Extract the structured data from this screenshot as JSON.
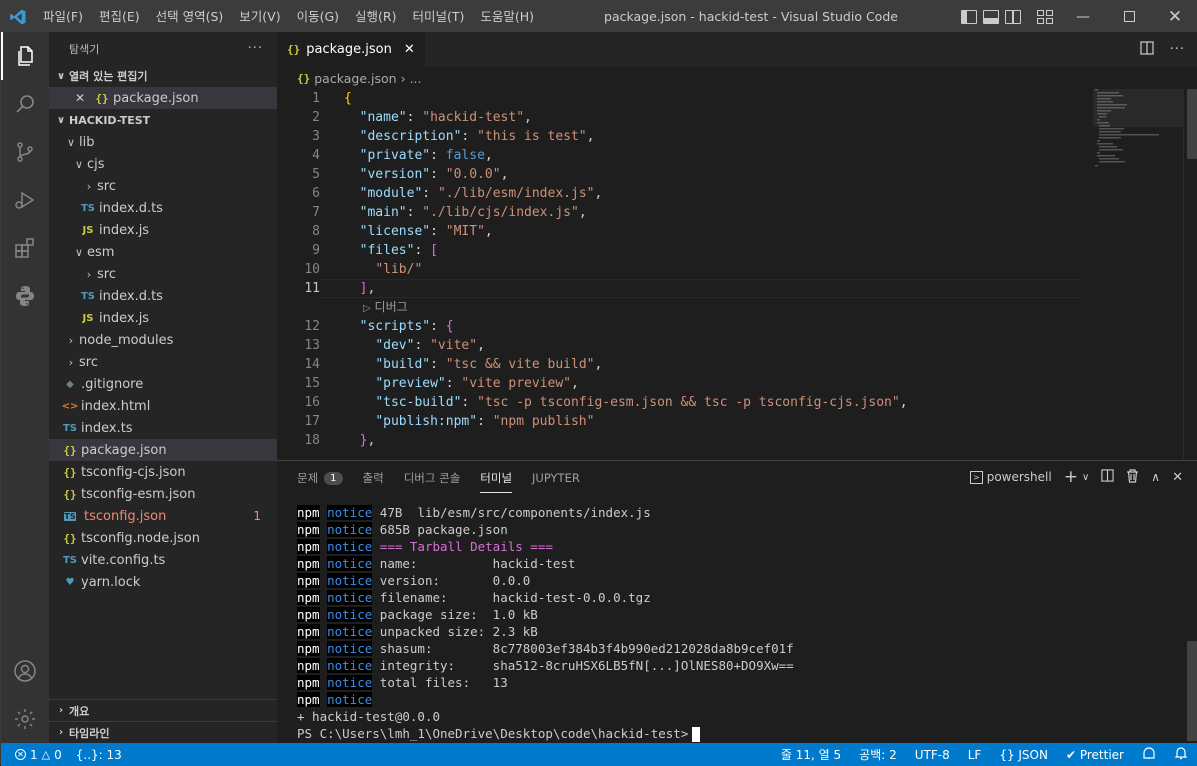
{
  "titlebar": {
    "menu": [
      "파일(F)",
      "편집(E)",
      "선택 영역(S)",
      "보기(V)",
      "이동(G)",
      "실행(R)",
      "터미널(T)",
      "도움말(H)"
    ],
    "title": "package.json - hackid-test - Visual Studio Code"
  },
  "sidebar": {
    "title": "탐색기",
    "more": "···",
    "open_editors_label": "열려 있는 편집기",
    "open_editor_file": "package.json",
    "project_label": "HACKID-TEST",
    "tree": [
      {
        "label": "lib",
        "type": "folder-open"
      },
      {
        "label": "cjs",
        "type": "folder-open"
      },
      {
        "label": "src",
        "type": "folder"
      },
      {
        "label": "index.d.ts",
        "icon": "TS"
      },
      {
        "label": "index.js",
        "icon": "JS"
      },
      {
        "label": "esm",
        "type": "folder-open"
      },
      {
        "label": "src",
        "type": "folder"
      },
      {
        "label": "index.d.ts",
        "icon": "TS"
      },
      {
        "label": "index.js",
        "icon": "JS"
      },
      {
        "label": "node_modules",
        "type": "folder"
      },
      {
        "label": "src",
        "type": "folder"
      },
      {
        "label": ".gitignore",
        "icon": "git"
      },
      {
        "label": "index.html",
        "icon": "<>"
      },
      {
        "label": "index.ts",
        "icon": "TS"
      },
      {
        "label": "package.json",
        "icon": "{}"
      },
      {
        "label": "tsconfig-cjs.json",
        "icon": "{}"
      },
      {
        "label": "tsconfig-esm.json",
        "icon": "{}"
      },
      {
        "label": "tsconfig.json",
        "icon": "TS",
        "badge": "1"
      },
      {
        "label": "tsconfig.node.json",
        "icon": "{}"
      },
      {
        "label": "vite.config.ts",
        "icon": "TS"
      },
      {
        "label": "yarn.lock",
        "icon": "yarn"
      }
    ],
    "outline_label": "개요",
    "timeline_label": "타임라인"
  },
  "editor": {
    "tab_label": "package.json",
    "breadcrumb_file": "package.json",
    "breadcrumb_more": "...",
    "codelens": "디버그",
    "line_numbers": [
      "1",
      "2",
      "3",
      "4",
      "5",
      "6",
      "7",
      "8",
      "9",
      "10",
      "11",
      "12",
      "13",
      "14",
      "15",
      "16",
      "17",
      "18"
    ],
    "current_line": "11"
  },
  "panel": {
    "tabs": [
      "문제",
      "출력",
      "디버그 콘솔",
      "터미널",
      "JUPYTER"
    ],
    "problems_count": "1",
    "active_tab": "터미널",
    "shell": "powershell",
    "terminal_lines": [
      {
        "text": " 47B  lib/esm/src/components/index.js"
      },
      {
        "text": " 685B package.json"
      },
      {
        "text": " === Tarball Details ===",
        "magenta": true
      },
      {
        "text": " name:          hackid-test"
      },
      {
        "text": " version:       0.0.0"
      },
      {
        "text": " filename:      hackid-test-0.0.0.tgz"
      },
      {
        "text": " package size:  1.0 kB"
      },
      {
        "text": " unpacked size: 2.3 kB"
      },
      {
        "text": " shasum:        8c778003ef384b3f4b990ed212028da8b9cef01f"
      },
      {
        "text": " integrity:     sha512-8cruHSX6LB5fN[...]OlNES80+DO9Xw=="
      },
      {
        "text": " total files:   13"
      },
      {
        "text": ""
      }
    ],
    "npm_tag": "npm",
    "notice_tag": "notice",
    "result_line": "+ hackid-test@0.0.0",
    "prompt": "PS C:\\Users\\lmh_1\\OneDrive\\Desktop\\code\\hackid-test>"
  },
  "statusbar": {
    "errors": "1",
    "warnings": "0",
    "brackets": "{..}: 13",
    "position": "줄 11, 열 5",
    "spaces": "공백: 2",
    "encoding": "UTF-8",
    "eol": "LF",
    "language": "{} JSON",
    "formatter": "✔ Prettier"
  },
  "colors": {
    "accent": "#007acc",
    "titlebar": "#3c3c3c",
    "sidebar": "#252526",
    "editor": "#1e1e1e"
  }
}
